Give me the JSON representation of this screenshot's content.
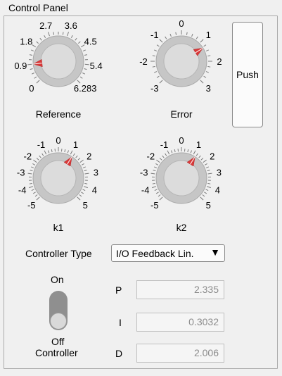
{
  "panel": {
    "title": "Control Panel"
  },
  "knobs": [
    {
      "id": "reference",
      "label": "Reference",
      "ticks": [
        "0",
        "0.9",
        "1.8",
        "2.7",
        "3.6",
        "4.5",
        "5.4",
        "6.283"
      ],
      "value": 0.9
    },
    {
      "id": "error",
      "label": "Error",
      "ticks": [
        "-3",
        "-2",
        "-1",
        "0",
        "1",
        "2",
        "3"
      ],
      "value": 1.3
    },
    {
      "id": "k1",
      "label": "k1",
      "ticks": [
        "-5",
        "-4",
        "-3",
        "-2",
        "-1",
        "0",
        "1",
        "2",
        "3",
        "4",
        "5"
      ],
      "value": 1.2
    },
    {
      "id": "k2",
      "label": "k2",
      "ticks": [
        "-5",
        "-4",
        "-3",
        "-2",
        "-1",
        "0",
        "1",
        "2",
        "3",
        "4",
        "5"
      ],
      "value": 1.2
    }
  ],
  "push_button": {
    "label": "Push"
  },
  "controller_type": {
    "label": "Controller Type",
    "selected": "I/O Feedback Lin."
  },
  "switch": {
    "on_label": "On",
    "off_label": "Off",
    "caption": "Controller",
    "state": "Off"
  },
  "gains": {
    "p": {
      "label": "P",
      "value": "2.335"
    },
    "i": {
      "label": "I",
      "value": "0.3032"
    },
    "d": {
      "label": "D",
      "value": "2.006"
    }
  }
}
